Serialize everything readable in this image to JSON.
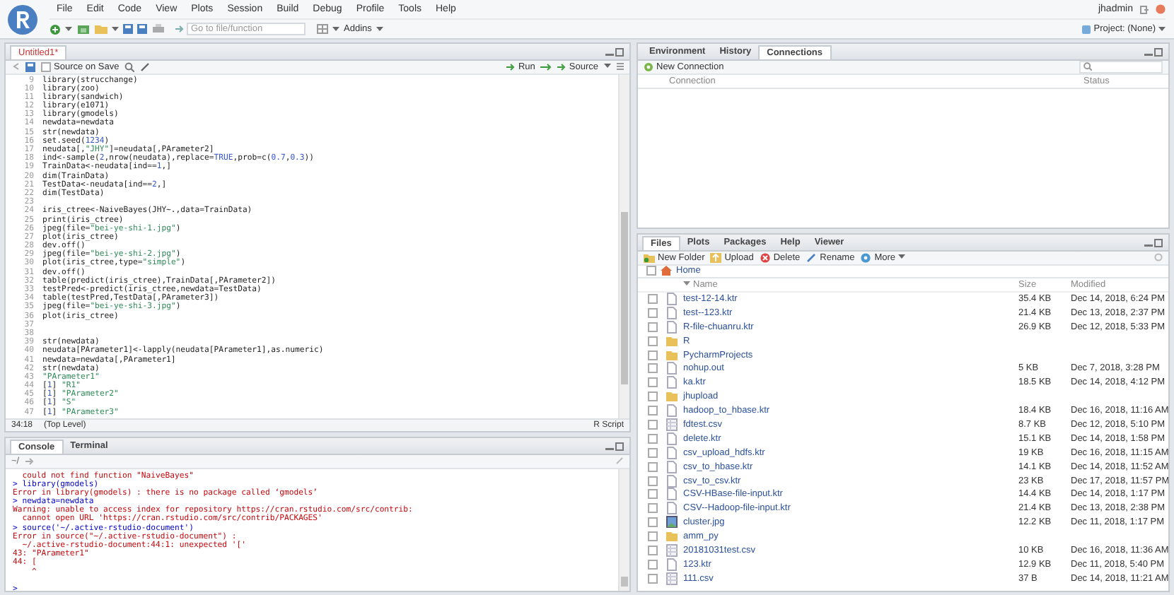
{
  "menu": [
    "File",
    "Edit",
    "Code",
    "View",
    "Plots",
    "Session",
    "Build",
    "Debug",
    "Profile",
    "Tools",
    "Help"
  ],
  "toolbar": {
    "goto_placeholder": "Go to file/function",
    "addins": "Addins"
  },
  "user": {
    "name": "jhadmin",
    "project": "Project: (None)"
  },
  "editor": {
    "tabs": [
      {
        "label": "Untitled1*",
        "selected": true
      }
    ],
    "source_on_save": {
      "label": "Source on Save",
      "checked": false
    },
    "run": "Run",
    "source": "Source",
    "lines": [
      {
        "number": "9",
        "text": "library(strucchange)"
      },
      {
        "number": "10",
        "text": "library(zoo)"
      },
      {
        "number": "11",
        "text": "library(sandwich)"
      },
      {
        "number": "12",
        "text": "library(e1071)"
      },
      {
        "number": "13",
        "text": "library(gmodels)"
      },
      {
        "number": "14",
        "text": "newdata=newdata"
      },
      {
        "number": "15",
        "text": "str(newdata)"
      },
      {
        "number": "16",
        "text": "set.seed(1234)"
      },
      {
        "number": "17",
        "text": "neudata[,\"JHY\"]=neudata[,PArameter2]"
      },
      {
        "number": "18",
        "text": "ind<-sample(2,nrow(neudata),replace=TRUE,prob=c(0.7,0.3))"
      },
      {
        "number": "19",
        "text": "TrainData<-neudata[ind==1,]"
      },
      {
        "number": "20",
        "text": "dim(TrainData)"
      },
      {
        "number": "21",
        "text": "TestData<-neudata[ind==2,]"
      },
      {
        "number": "22",
        "text": "dim(TestData)"
      },
      {
        "number": "23"
      },
      {
        "number": "24",
        "text": "iris_ctree<-NaiveBayes(JHY~.,data=TrainData)"
      },
      {
        "number": "25",
        "text": "print(iris_ctree)"
      },
      {
        "number": "26",
        "text": "jpeg(file=\"bei-ye-shi-1.jpg\")"
      },
      {
        "number": "27",
        "text": "plot(iris_ctree)"
      },
      {
        "number": "28",
        "text": "dev.off()"
      },
      {
        "number": "29",
        "text": "jpeg(file=\"bei-ye-shi-2.jpg\")"
      },
      {
        "number": "30",
        "text": "plot(iris_ctree,type=\"simple\")"
      },
      {
        "number": "31",
        "text": "dev.off()"
      },
      {
        "number": "32",
        "text": "table(predict(iris_ctree),TrainData[,PArameter2])"
      },
      {
        "number": "33",
        "text": "testPred<-predict(iris_ctree,newdata=TestData)"
      },
      {
        "number": "34",
        "text": "table(testPred,TestData[,PArameter3])"
      },
      {
        "number": "35",
        "text": "jpeg(file=\"bei-ye-shi-3.jpg\")"
      },
      {
        "number": "36",
        "text": "plot(iris_ctree)"
      },
      {
        "number": "37"
      },
      {
        "number": "38"
      },
      {
        "number": "39",
        "text": "str(newdata)"
      },
      {
        "number": "40",
        "text": "neudata[PArameter1]<-lapply(neudata[PArameter1],as.numeric)"
      },
      {
        "number": "41",
        "text": "newdata=newdata[,PArameter1]"
      },
      {
        "number": "42",
        "text": "str(newdata)"
      },
      {
        "number": "43",
        "text": "\"PArameter1\""
      },
      {
        "number": "44",
        "text": "[1] \"R1\""
      },
      {
        "number": "45",
        "text": "[1] \"PArameter2\""
      },
      {
        "number": "46",
        "text": "[1] \"S\""
      },
      {
        "number": "47",
        "text": "[1] \"PArameter3\""
      }
    ],
    "status": {
      "position": "34:18",
      "scope": "(Top Level)",
      "filetype": "R Script"
    }
  },
  "console": {
    "tabs": [
      {
        "label": "Console",
        "selected": true
      },
      {
        "label": "Terminal",
        "selected": false
      }
    ],
    "path": "~/",
    "lines": [
      {
        "kind": "error",
        "text": "  could not find function \"NaiveBayes\""
      },
      {
        "kind": "input",
        "text": "> library(gmodels)"
      },
      {
        "kind": "error",
        "text": "Error in library(gmodels) : there is no package called ‘gmodels’"
      },
      {
        "kind": "input",
        "text": "> newdata=newdata"
      },
      {
        "kind": "error",
        "text": "Warning: unable to access index for repository https://cran.rstudio.com/src/contrib:"
      },
      {
        "kind": "error",
        "text": "  cannot open URL 'https://cran.rstudio.com/src/contrib/PACKAGES'"
      },
      {
        "kind": "input",
        "text": "> source('~/.active-rstudio-document')"
      },
      {
        "kind": "error",
        "text": "Error in source(\"~/.active-rstudio-document\") :"
      },
      {
        "kind": "error",
        "text": "  ~/.active-rstudio-document:44:1: unexpected '['"
      },
      {
        "kind": "error",
        "text": "43: \"PArameter1\""
      },
      {
        "kind": "error",
        "text": "44: ["
      },
      {
        "kind": "error",
        "text": "    ^"
      },
      {
        "kind": "blank"
      },
      {
        "kind": "input",
        "text": ">"
      }
    ]
  },
  "environment": {
    "tabs": [
      {
        "label": "Environment",
        "selected": false
      },
      {
        "label": "History",
        "selected": false
      },
      {
        "label": "Connections",
        "selected": true
      }
    ],
    "new_connection": "New Connection",
    "columns": [
      "Connection",
      "Status"
    ]
  },
  "files": {
    "tabs": [
      {
        "label": "Files",
        "selected": true
      },
      {
        "label": "Plots",
        "selected": false
      },
      {
        "label": "Packages",
        "selected": false
      },
      {
        "label": "Help",
        "selected": false
      },
      {
        "label": "Viewer",
        "selected": false
      }
    ],
    "actions": [
      {
        "kind": "new-folder",
        "label": "New Folder"
      },
      {
        "kind": "upload",
        "label": "Upload"
      },
      {
        "kind": "delete",
        "label": "Delete"
      },
      {
        "kind": "rename",
        "label": "Rename"
      },
      {
        "kind": "more",
        "label": "More"
      }
    ],
    "breadcrumb": "Home",
    "columns": [
      "Name",
      "Size",
      "Modified"
    ],
    "rows": [
      {
        "kind": "file",
        "name": "test-12-14.ktr",
        "size": "35.4 KB",
        "modified": "Dec 14, 2018, 6:24 PM",
        "checked": false
      },
      {
        "kind": "file",
        "name": "test--123.ktr",
        "size": "21.4 KB",
        "modified": "Dec 13, 2018, 2:37 PM",
        "checked": false
      },
      {
        "kind": "file",
        "name": "R-file-chuanru.ktr",
        "size": "26.9 KB",
        "modified": "Dec 12, 2018, 5:33 PM",
        "checked": false
      },
      {
        "kind": "folder",
        "name": "R",
        "checked": false
      },
      {
        "kind": "folder",
        "name": "PycharmProjects",
        "checked": false
      },
      {
        "kind": "file",
        "name": "nohup.out",
        "size": "5 KB",
        "modified": "Dec 7, 2018, 3:28 PM",
        "checked": false
      },
      {
        "kind": "file",
        "name": "ka.ktr",
        "size": "18.5 KB",
        "modified": "Dec 14, 2018, 4:12 PM",
        "checked": false
      },
      {
        "kind": "folder",
        "name": "jhupload",
        "checked": false
      },
      {
        "kind": "file",
        "name": "hadoop_to_hbase.ktr",
        "size": "18.4 KB",
        "modified": "Dec 16, 2018, 11:16 AM",
        "checked": false
      },
      {
        "kind": "table",
        "name": "fdtest.csv",
        "size": "8.7 KB",
        "modified": "Dec 12, 2018, 5:10 PM",
        "checked": false
      },
      {
        "kind": "file",
        "name": "delete.ktr",
        "size": "15.1 KB",
        "modified": "Dec 14, 2018, 1:58 PM",
        "checked": false
      },
      {
        "kind": "file",
        "name": "csv_upload_hdfs.ktr",
        "size": "19 KB",
        "modified": "Dec 16, 2018, 11:15 AM",
        "checked": false
      },
      {
        "kind": "file",
        "name": "csv_to_hbase.ktr",
        "size": "14.1 KB",
        "modified": "Dec 14, 2018, 11:52 AM",
        "checked": false
      },
      {
        "kind": "file",
        "name": "csv_to_csv.ktr",
        "size": "23 KB",
        "modified": "Dec 17, 2018, 11:57 PM",
        "checked": false
      },
      {
        "kind": "file",
        "name": "CSV-HBase-file-input.ktr",
        "size": "14.4 KB",
        "modified": "Dec 14, 2018, 1:17 PM",
        "checked": false
      },
      {
        "kind": "file",
        "name": "CSV--Hadoop-file-input.ktr",
        "size": "21.4 KB",
        "modified": "Dec 13, 2018, 2:38 PM",
        "checked": false
      },
      {
        "kind": "image",
        "name": "cluster.jpg",
        "size": "12.2 KB",
        "modified": "Dec 11, 2018, 1:17 PM",
        "checked": false
      },
      {
        "kind": "folder",
        "name": "amm_py",
        "checked": false
      },
      {
        "kind": "table",
        "name": "20181031test.csv",
        "size": "10 KB",
        "modified": "Dec 16, 2018, 11:36 AM",
        "checked": false
      },
      {
        "kind": "file",
        "name": "123.ktr",
        "size": "12.9 KB",
        "modified": "Dec 11, 2018, 5:40 PM",
        "checked": false
      },
      {
        "kind": "table",
        "name": "111.csv",
        "size": "37 B",
        "modified": "Dec 14, 2018, 11:21 AM",
        "checked": false
      }
    ]
  }
}
